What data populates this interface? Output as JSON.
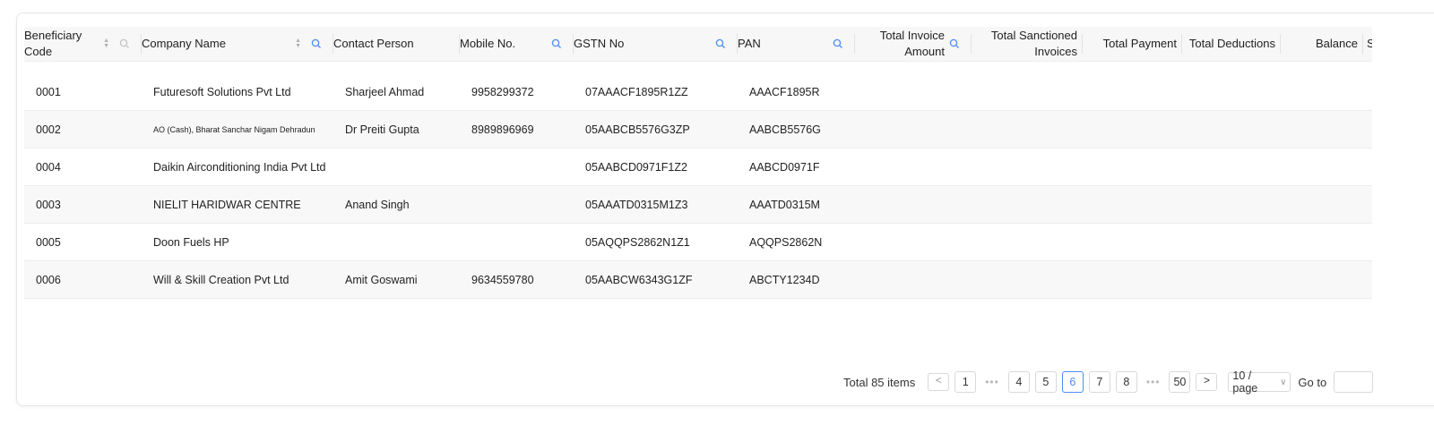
{
  "columns": [
    {
      "label": "Beneficiary Code",
      "sortable": true,
      "searchable": true
    },
    {
      "label": "Company Name",
      "sortable": true,
      "searchable": true
    },
    {
      "label": "Contact Person",
      "sortable": false,
      "searchable": false
    },
    {
      "label": "Mobile No.",
      "sortable": false,
      "searchable": true
    },
    {
      "label": "GSTN No",
      "sortable": false,
      "searchable": true
    },
    {
      "label": "PAN",
      "sortable": false,
      "searchable": true
    },
    {
      "label": "Total Invoice Amount",
      "sortable": false,
      "searchable": true
    },
    {
      "label": "Total Sanctioned Invoices",
      "sortable": false,
      "searchable": false
    },
    {
      "label": "Total Payment",
      "sortable": false,
      "searchable": false
    },
    {
      "label": "Total Deductions",
      "sortable": false,
      "searchable": false
    },
    {
      "label": "Balance",
      "sortable": false,
      "searchable": false
    },
    {
      "label": "St",
      "sortable": false,
      "searchable": false
    }
  ],
  "rows": [
    {
      "code": "0001",
      "company": "Futuresoft  Solutions Pvt Ltd",
      "contact": "Sharjeel Ahmad",
      "mobile": "9958299372",
      "gstn": "07AAACF1895R1ZZ",
      "pan": "AAACF1895R"
    },
    {
      "code": "0002",
      "company": "AO (Cash), Bharat Sanchar Nigam Dehradun",
      "contact": "Dr Preiti Gupta",
      "mobile": "8989896969",
      "gstn": "05AABCB5576G3ZP",
      "pan": "AABCB5576G"
    },
    {
      "code": "0004",
      "company": "Daikin Airconditioning India Pvt Ltd",
      "contact": "",
      "mobile": "",
      "gstn": "05AABCD0971F1Z2",
      "pan": "AABCD0971F"
    },
    {
      "code": "0003",
      "company": "NIELIT HARIDWAR CENTRE",
      "contact": "Anand Singh",
      "mobile": "",
      "gstn": "05AAATD0315M1Z3",
      "pan": "AAATD0315M"
    },
    {
      "code": "0005",
      "company": "Doon Fuels HP",
      "contact": "",
      "mobile": "",
      "gstn": "05AQQPS2862N1Z1",
      "pan": "AQQPS2862N"
    },
    {
      "code": "0006",
      "company": "Will & Skill Creation Pvt Ltd",
      "contact": "Amit Goswami",
      "mobile": "9634559780",
      "gstn": "05AABCW6343G1ZF",
      "pan": "ABCTY1234D"
    }
  ],
  "pagination": {
    "total_label": "Total 85 items",
    "prev": "<",
    "next": ">",
    "pages": [
      "1",
      "4",
      "5",
      "6",
      "7",
      "8",
      "50"
    ],
    "current": "6",
    "ellipsis": "•••",
    "page_size": "10 / page",
    "goto_label": "Go to"
  },
  "colors": {
    "accent": "#4c8df6",
    "header_bg": "#f7f7f7",
    "stripe_bg": "#f8f8f8"
  }
}
